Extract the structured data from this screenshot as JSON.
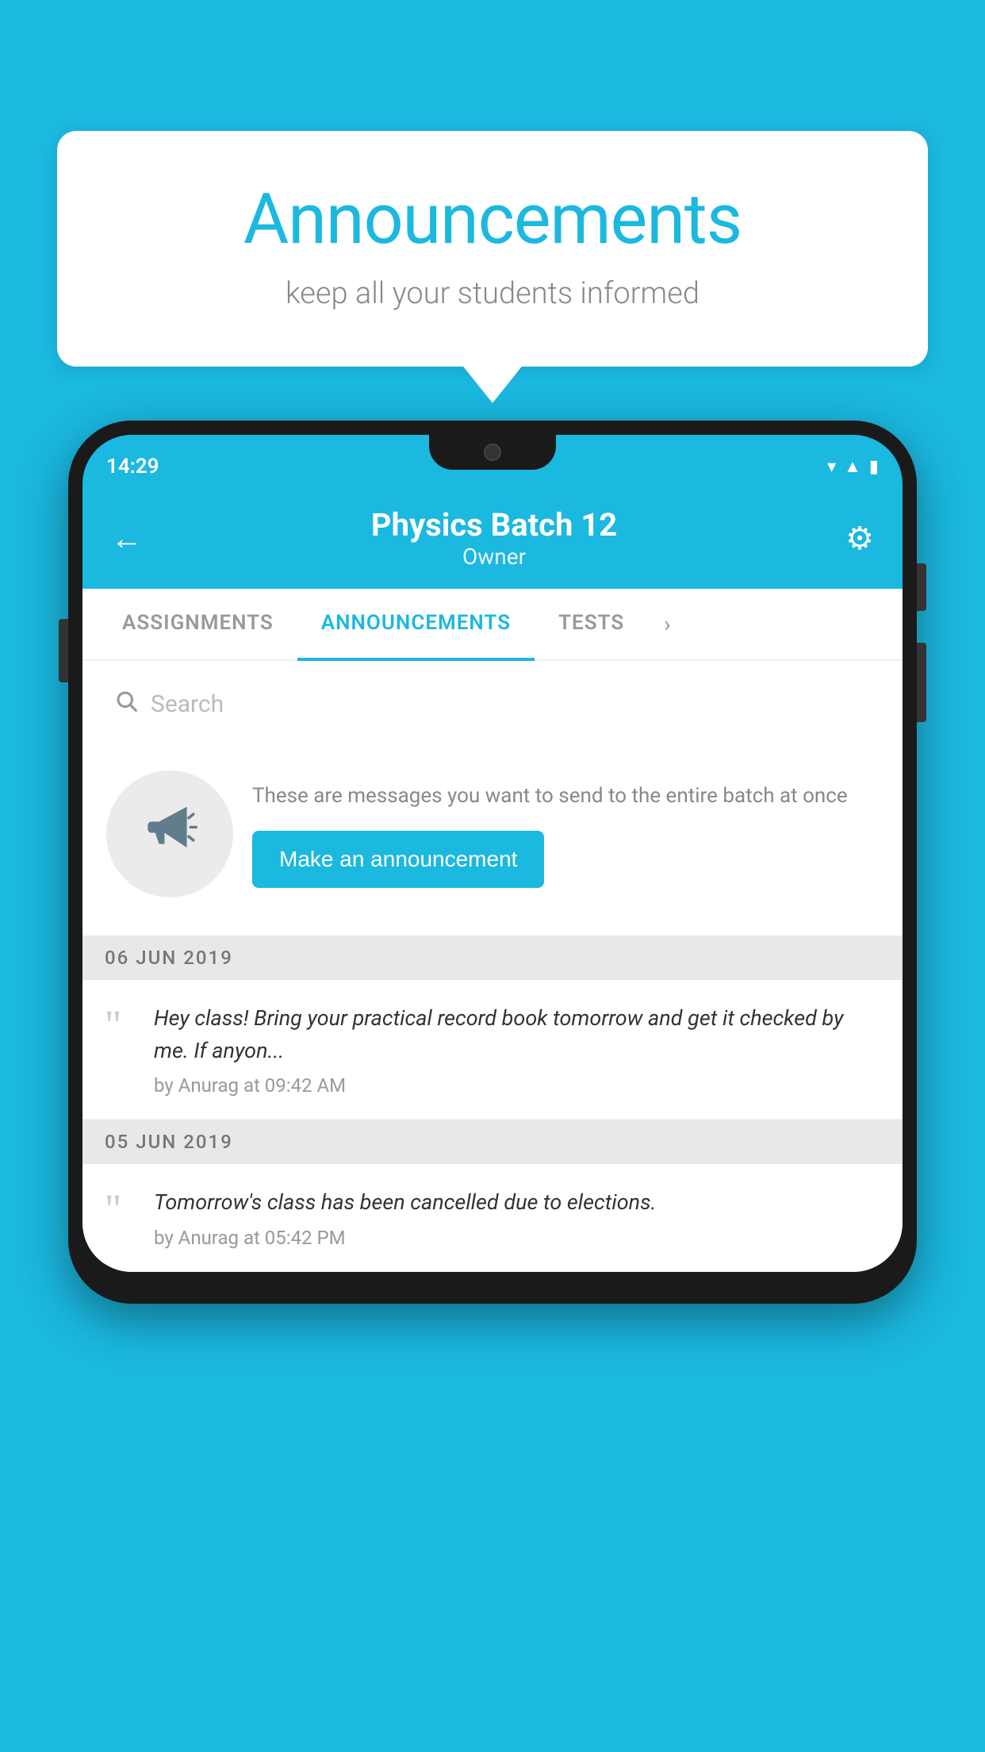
{
  "background_color": "#1bb8e0",
  "speech_bubble": {
    "title": "Announcements",
    "subtitle": "keep all your students informed"
  },
  "phone": {
    "status_bar": {
      "time": "14:29",
      "icons": [
        "wifi",
        "signal",
        "battery"
      ]
    },
    "header": {
      "batch_name": "Physics Batch 12",
      "role": "Owner",
      "back_label": "←",
      "settings_label": "⚙"
    },
    "tabs": [
      {
        "label": "ASSIGNMENTS",
        "active": false
      },
      {
        "label": "ANNOUNCEMENTS",
        "active": true
      },
      {
        "label": "TESTS",
        "active": false
      }
    ],
    "search": {
      "placeholder": "Search"
    },
    "promo": {
      "description": "These are messages you want to send to the entire batch at once",
      "button_label": "Make an announcement"
    },
    "announcements": [
      {
        "date": "06  JUN  2019",
        "text": "Hey class! Bring your practical record book tomorrow and get it checked by me. If anyon...",
        "meta": "by Anurag at 09:42 AM"
      },
      {
        "date": "05  JUN  2019",
        "text": "Tomorrow's class has been cancelled due to elections.",
        "meta": "by Anurag at 05:42 PM"
      }
    ]
  }
}
